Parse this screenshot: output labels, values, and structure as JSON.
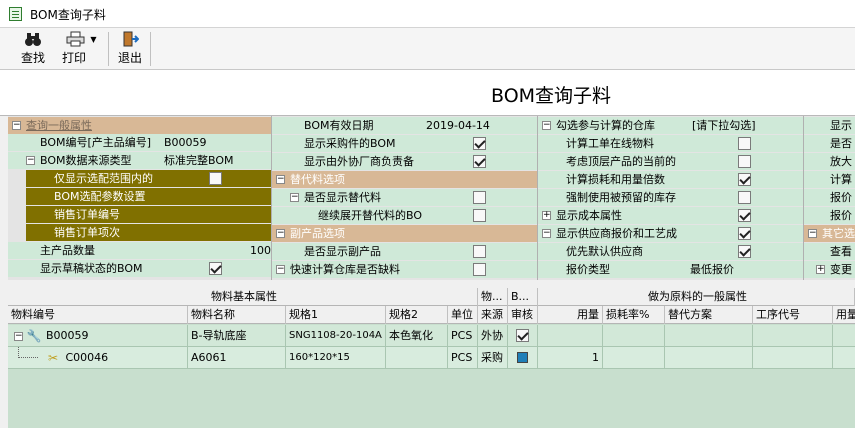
{
  "window": {
    "title": "BOM查询子料"
  },
  "toolbar": {
    "find": "查找",
    "print": "打印",
    "exit": "退出"
  },
  "header": {
    "title": "BOM查询子料"
  },
  "col1": {
    "section_general": "查询一般属性",
    "bom_no_label": "BOM编号[产主品编号]",
    "bom_no_value": "B00059",
    "source_type_label": "BOM数据来源类型",
    "source_type_value": "标准完整BOM",
    "show_only_match": "仅显示选配范围内的",
    "match_params": "BOM选配参数设置",
    "sales_order_no": "销售订单编号",
    "sales_order_item": "销售订单项次",
    "main_qty_label": "主产品数量",
    "main_qty_value": "100",
    "show_draft": "显示草稿状态的BOM"
  },
  "col2": {
    "effective_date_label": "BOM有效日期",
    "effective_date_value": "2019-04-14",
    "show_purchased": "显示采购件的BOM",
    "show_outsourced": "显示由外协厂商负责备",
    "section_sub": "替代料选项",
    "show_sub": "是否显示替代料",
    "expand_sub": "继续展开替代料的BO",
    "section_byproduct": "副产品选项",
    "show_byproduct": "是否显示副产品",
    "quick_calc": "快速计算仓库是否缺料"
  },
  "col3": {
    "warehouses_label": "勾选参与计算的仓库",
    "warehouses_value": "[请下拉勾选]",
    "calc_online": "计算工单在线物料",
    "consider_top": "考虑顶层产品的当前的",
    "calc_loss": "计算损耗和用量倍数",
    "force_reserved": "强制使用被预留的库存",
    "show_cost": "显示成本属性",
    "show_supplier_quote": "显示供应商报价和工艺成",
    "prefer_default_supplier": "优先默认供应商",
    "quote_type_label": "报价类型",
    "quote_type_value": "最低报价"
  },
  "col4": {
    "items": [
      "显示",
      "是否",
      "放大",
      "计算",
      "报价",
      "报价"
    ],
    "section_other": "其它选项",
    "view": "查看",
    "change": "变更"
  },
  "grid": {
    "group_basic": "物料基本属性",
    "group_mid1": "物...",
    "group_mid2": "B...",
    "group_general": "做为原料的一般属性",
    "columns": [
      "物料编号",
      "物料名称",
      "规格1",
      "规格2",
      "单位",
      "来源",
      "审核",
      "用量",
      "损耗率%",
      "替代方案",
      "工序代号",
      "用量"
    ],
    "rows": [
      {
        "code": "B00059",
        "name": "B-导轨底座",
        "spec1": "SNG1108-20-104A",
        "spec2": "本色氧化",
        "unit": "PCS",
        "source": "外协",
        "qty": ""
      },
      {
        "code": "C00046",
        "name": "A6061",
        "spec1": "160*120*15",
        "spec2": "",
        "unit": "PCS",
        "source": "采购",
        "qty": "1"
      }
    ]
  },
  "colors": {
    "section": "#d8b896",
    "olive": "#807000",
    "green": "#cfe9d8",
    "grid_bg": "#c8dfce"
  },
  "icons": [
    "binoculars-icon",
    "printer-icon",
    "exit-door-icon",
    "checkbox-icon",
    "blue-box-icon"
  ]
}
